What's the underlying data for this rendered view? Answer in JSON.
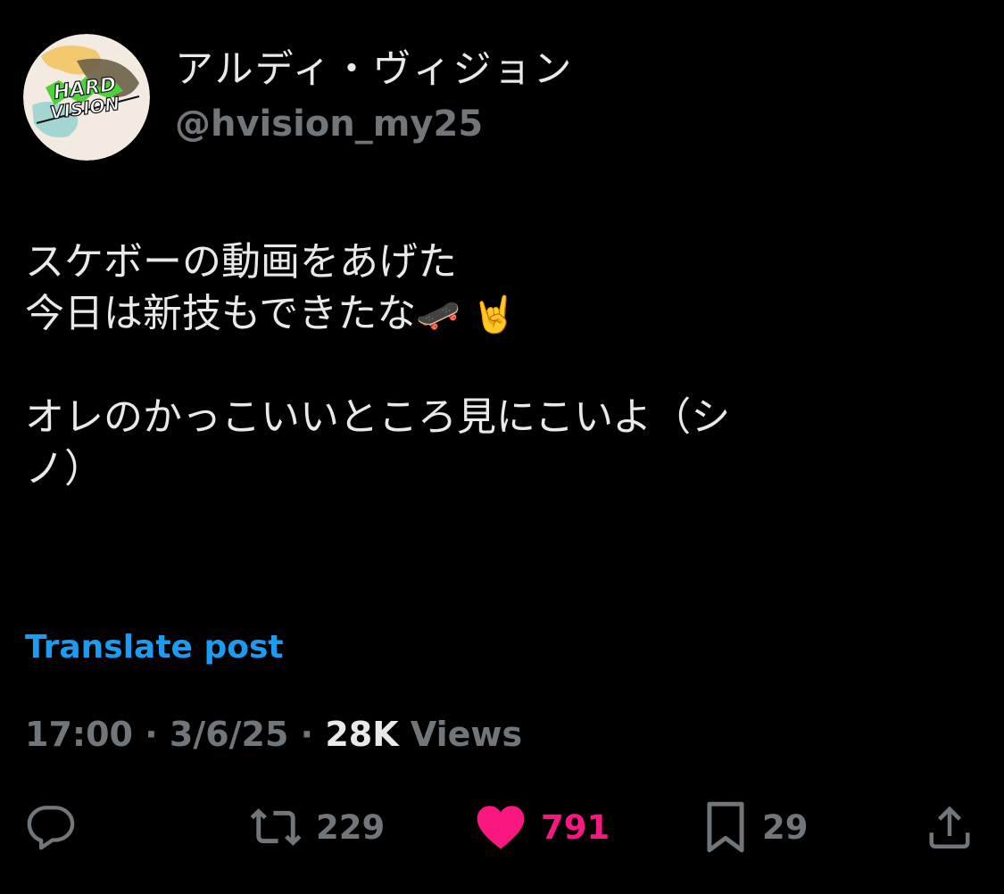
{
  "author": {
    "display_name": "アルディ・ヴィジョン",
    "handle": "@hvision_my25",
    "avatar_text": [
      "HARD",
      "VISION"
    ]
  },
  "post": {
    "lines": [
      "スケボーの動画をあげた",
      "今日は新技もできたな",
      "",
      "オレのかっこいいところ見にこいよ（シ",
      "ノ）"
    ],
    "line2_emojis": "🛹 🤘"
  },
  "translate_label": "Translate post",
  "meta": {
    "time": "17:00",
    "separator": "·",
    "date": "3/6/25",
    "views_count": "28K",
    "views_label": "Views"
  },
  "actions": {
    "reply": {
      "icon": "reply-icon",
      "count": ""
    },
    "repost": {
      "icon": "repost-icon",
      "count": "229"
    },
    "like": {
      "icon": "heart-icon",
      "count": "791",
      "liked": true
    },
    "bookmark": {
      "icon": "bookmark-icon",
      "count": "29"
    },
    "share": {
      "icon": "share-icon",
      "count": ""
    }
  },
  "colors": {
    "background": "#000000",
    "primary_text": "#e7e9ea",
    "secondary_text": "#71767b",
    "link": "#1d9bf0",
    "like": "#f91880"
  }
}
